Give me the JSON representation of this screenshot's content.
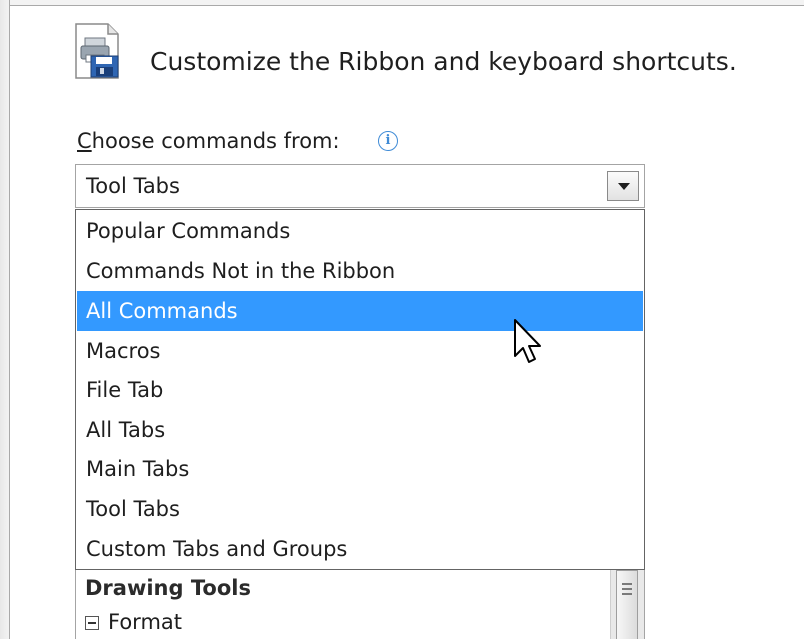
{
  "header": {
    "title": "Customize the Ribbon and keyboard shortcuts.",
    "icon": "customize-ribbon-icon"
  },
  "choose_commands": {
    "label_first_char": "C",
    "label_rest": "hoose commands from:",
    "info_glyph": "i",
    "selected_value": "Tool Tabs",
    "options": [
      {
        "label": "Popular Commands",
        "highlighted": false
      },
      {
        "label": "Commands Not in the Ribbon",
        "highlighted": false
      },
      {
        "label": "All Commands",
        "highlighted": true
      },
      {
        "label": "Macros",
        "highlighted": false
      },
      {
        "label": "File Tab",
        "highlighted": false
      },
      {
        "label": "All Tabs",
        "highlighted": false
      },
      {
        "label": "Main Tabs",
        "highlighted": false
      },
      {
        "label": "Tool Tabs",
        "highlighted": false
      },
      {
        "label": "Custom Tabs and Groups",
        "highlighted": false
      }
    ]
  },
  "commands_list": {
    "group_header": "Drawing Tools",
    "items": [
      {
        "label": "Format"
      }
    ]
  },
  "colors": {
    "highlight": "#3399ff",
    "highlight_text": "#ffffff",
    "info_blue": "#3f8bd6"
  }
}
